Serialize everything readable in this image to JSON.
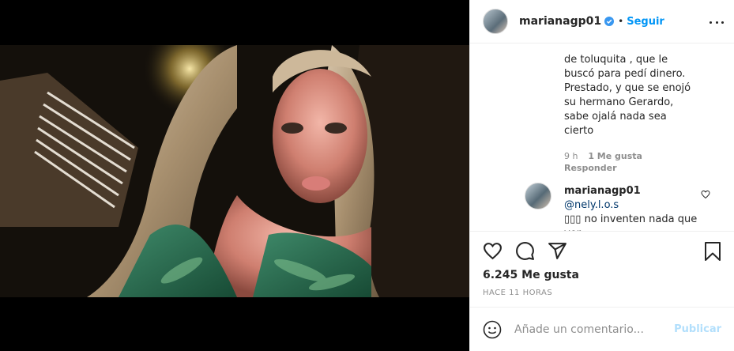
{
  "post": {
    "username": "marianagp01",
    "follow_label": "Seguir",
    "separator": "•",
    "likes": "6.245 Me gusta",
    "timestamp": "HACE 11 HORAS"
  },
  "comment": {
    "text_lines": [
      "de toluquita , que le",
      "buscó para pedí dinero.",
      "Prestado, y que se enojó",
      "su hermano Gerardo,",
      "sabe ojalá nada sea",
      "cierto"
    ],
    "time": "9 h",
    "likes": "1 Me gusta",
    "reply_label": "Responder"
  },
  "reply": {
    "username": "marianagp01",
    "mention": "@nely.l.o.s",
    "text": "▯▯▯ no inventen nada que ver"
  },
  "composer": {
    "placeholder": "Añade un comentario...",
    "publish_label": "Publicar"
  },
  "colors": {
    "accent": "#0095f6",
    "muted": "#8e8e8e",
    "text": "#262626",
    "publish_disabled": "#b2dffc"
  },
  "icons": [
    "more-icon",
    "heart-icon",
    "comment-icon",
    "share-icon",
    "bookmark-icon",
    "smile-icon",
    "verified-icon"
  ]
}
